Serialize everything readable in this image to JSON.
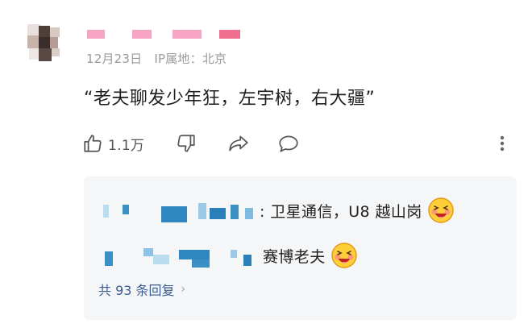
{
  "comment": {
    "meta": {
      "date": "12月23日",
      "ip_label": "IP属地：北京"
    },
    "text": "“老夫聊发少年狂，左宇树，右大疆”",
    "likes": "1.1万"
  },
  "icons": {
    "like": "thumbs-up-icon",
    "dislike": "thumbs-down-icon",
    "share": "share-icon",
    "reply": "comment-icon",
    "more": "more-vertical-icon"
  },
  "replies": {
    "items": [
      {
        "text": ": 卫星通信，U8 越山岗",
        "emoji": "laughing-face-emoji"
      },
      {
        "text": "赛博老夫",
        "emoji": "laughing-face-emoji"
      }
    ],
    "total_label": "共 93 条回复"
  },
  "colors": {
    "link_blue": "#3b5d8f",
    "username_pink": "#f7a3c3",
    "meta_gray": "#9a9a9a",
    "reply_bg": "#f5f6f7"
  }
}
